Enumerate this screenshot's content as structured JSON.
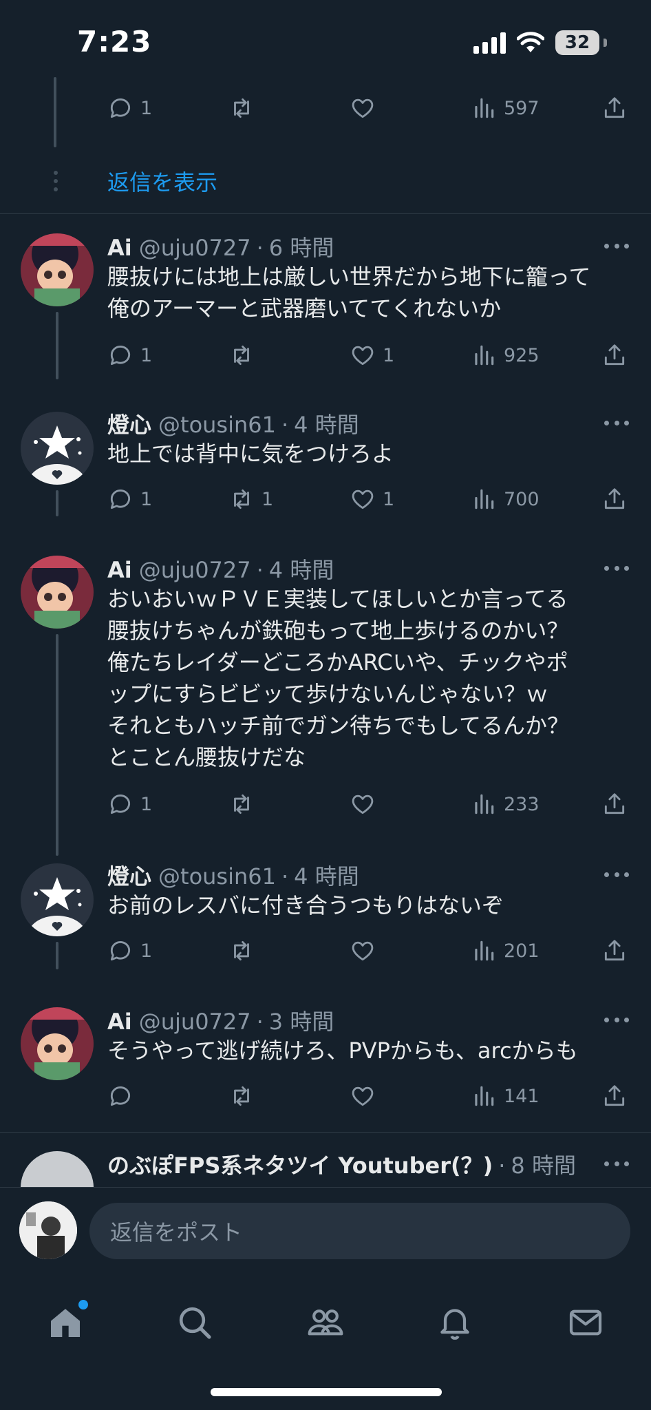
{
  "status_bar": {
    "time": "7:23",
    "battery": "32"
  },
  "top": {
    "actions": {
      "replies": "1",
      "retweets": "",
      "likes": "",
      "views": "597"
    },
    "show_replies": "返信を表示"
  },
  "tweets": [
    {
      "name": "Ai",
      "handle": "@uju0727",
      "time": "6 時間",
      "lines": [
        "腰抜けには地上は厳しい世界だから地下に籠って",
        "俺のアーマーと武器磨いててくれないか"
      ],
      "replies": "1",
      "retweets": "",
      "likes": "1",
      "views": "925"
    },
    {
      "name": "燈心",
      "handle": "@tousin61",
      "time": "4 時間",
      "lines": [
        "地上では背中に気をつけろよ"
      ],
      "replies": "1",
      "retweets": "1",
      "likes": "1",
      "views": "700"
    },
    {
      "name": "Ai",
      "handle": "@uju0727",
      "time": "4 時間",
      "lines": [
        "おいおいｗＰＶＥ実装してほしいとか言ってる",
        "腰抜けちゃんが鉄砲もって地上歩けるのかい？",
        "俺たちレイダーどころかARCいや、チックやポ",
        "ップにすらビビッて歩けないんじゃない？ｗ",
        "それともハッチ前でガン待ちでもしてるんか？",
        "とことん腰抜けだな"
      ],
      "replies": "1",
      "retweets": "",
      "likes": "",
      "views": "233"
    },
    {
      "name": "燈心",
      "handle": "@tousin61",
      "time": "4 時間",
      "lines": [
        "お前のレスバに付き合うつもりはないぞ"
      ],
      "replies": "1",
      "retweets": "",
      "likes": "",
      "views": "201"
    },
    {
      "name": "Ai",
      "handle": "@uju0727",
      "time": "3 時間",
      "lines": [
        "そうやって逃げ続けろ、PVPからも、arcからも"
      ],
      "replies": "",
      "retweets": "",
      "likes": "",
      "views": "141"
    },
    {
      "name": "のぶぽFPS系ネタツイ Youtuber(？)",
      "handle": "",
      "time": "8 時間",
      "lines": [],
      "replies": "",
      "retweets": "",
      "likes": "",
      "views": ""
    }
  ],
  "composer": {
    "placeholder": "返信をポスト"
  },
  "tabs": [
    "home-icon",
    "search-icon",
    "communities-icon",
    "notifications-icon",
    "messages-icon"
  ],
  "colors": {
    "background": "#15202b",
    "accent": "#1d9bf0",
    "muted": "#8b98a5",
    "text": "#e7e9ea"
  }
}
